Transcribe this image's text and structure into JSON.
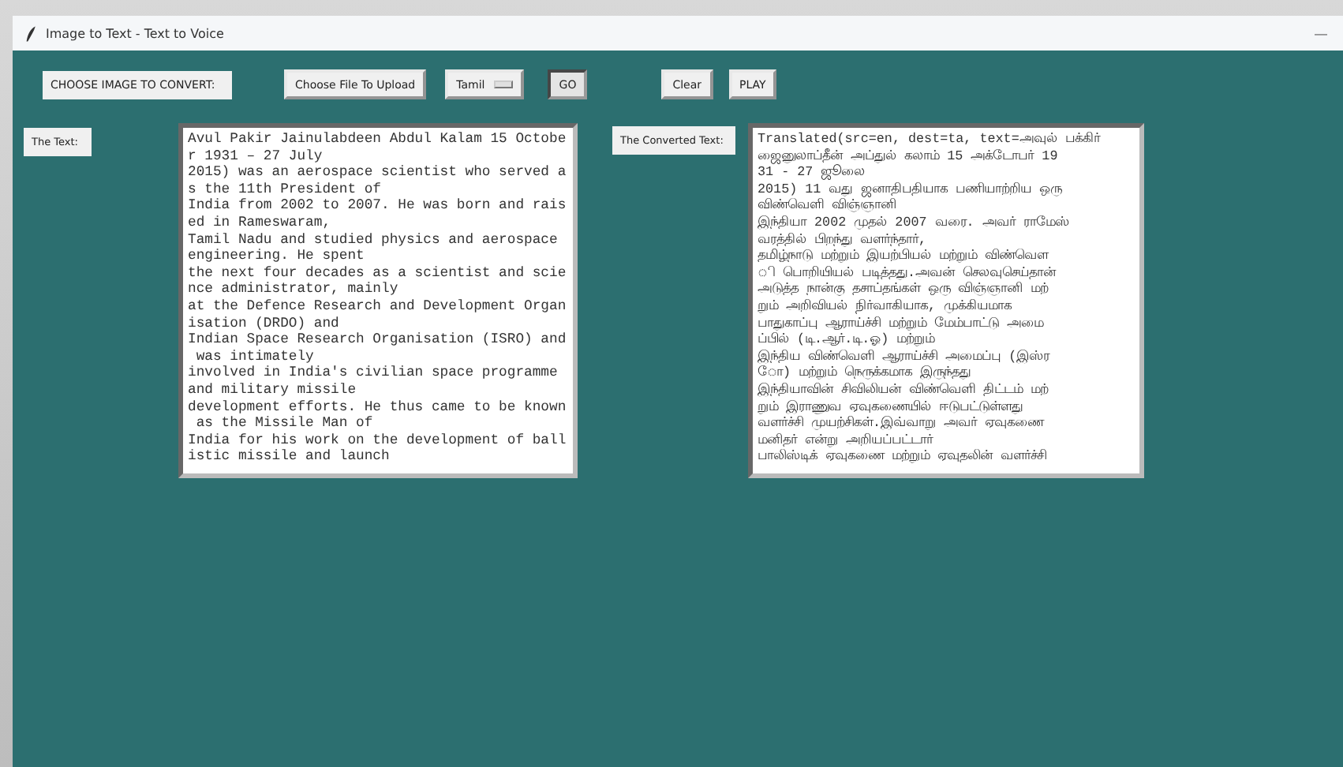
{
  "window": {
    "title": "Image to Text - Text to Voice",
    "minimize": "—"
  },
  "toolbar": {
    "prompt_label": "CHOOSE IMAGE TO CONVERT:",
    "controls": [
      {
        "kind": "button",
        "label": "Choose File To Upload",
        "pressed": false
      },
      {
        "kind": "dropdown",
        "label": "Tamil",
        "pressed": false
      },
      {
        "kind": "button",
        "label": "GO",
        "pressed": true
      },
      {
        "kind": "button",
        "label": "Clear",
        "pressed": false
      },
      {
        "kind": "button",
        "label": "PLAY",
        "pressed": false
      }
    ]
  },
  "source": {
    "label": "The Text:",
    "lines": [
      "Avul Pakir Jainulabdeen Abdul Kalam 15 Octobe",
      "r 1931 – 27 July",
      "2015) was an aerospace scientist who served a",
      "s the 11th President of",
      "India from 2002 to 2007. He was born and rais",
      "ed in Rameswaram,",
      "Tamil Nadu and studied physics and aerospace",
      "engineering. He spent",
      "the next four decades as a scientist and scie",
      "nce administrator, mainly",
      "at the Defence Research and Development Organ",
      "isation (DRDO) and",
      "Indian Space Research Organisation (ISRO) and",
      " was intimately",
      "involved in India's civilian space programme",
      "and military missile",
      "development efforts. He thus came to be known",
      " as the Missile Man of",
      "India for his work on the development of ball",
      "istic missile and launch"
    ]
  },
  "converted": {
    "label": "The Converted Text:",
    "lines": [
      "Translated(src=en, dest=ta, text=அவுல் பக்கிர்",
      "ஜைனுலாப்தீன் அப்துல் கலாம் 15 அக்டோபர் 19",
      "31 - 27 ஜூலை",
      "2015) 11 வது ஜனாதிபதியாக பணியாற்றிய ஒரு",
      "விண்வெளி விஞ்ஞானி",
      "இந்தியா 2002 முதல் 2007 வரை. அவர் ராமேஸ்",
      "வரத்தில் பிறந்து வளர்ந்தார்,",
      "தமிழ்நாடு மற்றும் இயற்பியல் மற்றும் விண்வெள",
      "ி பொறியியல் படித்தது.அவன் செலவுசெய்தான்",
      "அடுத்த நான்கு தசாப்தங்கள் ஒரு விஞ்ஞானி மற்",
      "றும் அறிவியல் நிர்வாகியாக, முக்கியமாக",
      "பாதுகாப்பு ஆராய்ச்சி மற்றும் மேம்பாட்டு அமை",
      "ப்பில் (டி.ஆர்.டி.ஓ) மற்றும்",
      "இந்திய விண்வெளி ஆராய்ச்சி அமைப்பு (இஸ்ர",
      "ோ) மற்றும் நெருக்கமாக இருந்தது",
      "இந்தியாவின் சிவிலியன் விண்வெளி திட்டம் மற்",
      "றும் இராணுவ ஏவுகணையில் ஈடுபட்டுள்ளது",
      "வளர்ச்சி முயற்சிகள்.இவ்வாறு அவர் ஏவுகணை",
      "மனிதர் என்று அறியப்பட்டார்",
      "பாலிஸ்டிக் ஏவுகணை மற்றும் ஏவுதலின் வளர்ச்சி"
    ]
  }
}
